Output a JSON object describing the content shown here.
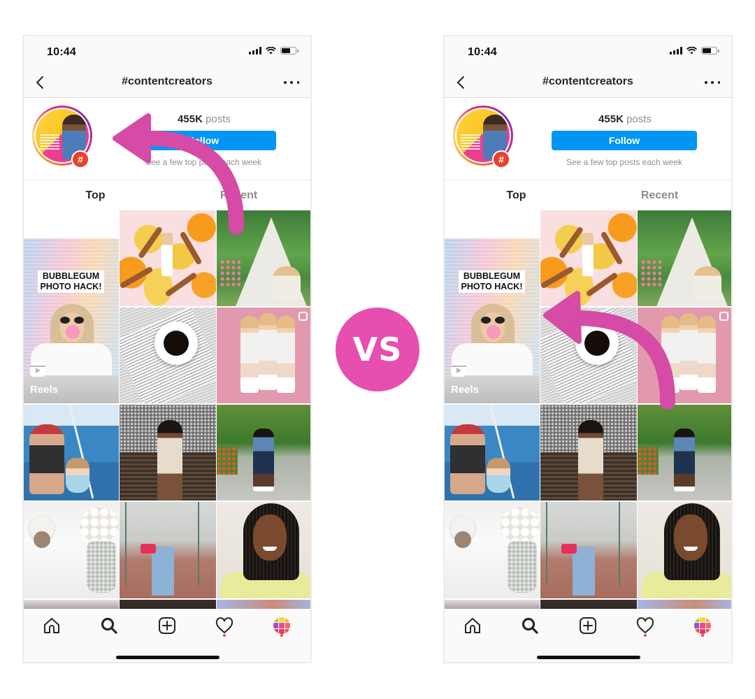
{
  "vs_label": "VS",
  "accent": {
    "arrow": "#d64ba6",
    "vs_circle": "#e64fb0",
    "follow": "#0095f6"
  },
  "phones": [
    {
      "id": "left",
      "arrow_target": "hashtag-profile-image",
      "status_bar": {
        "time": "10:44",
        "signal_icon": "cellular-signal-icon",
        "wifi_icon": "wifi-icon",
        "battery_icon": "battery-icon"
      },
      "header": {
        "back_icon": "chevron-left-icon",
        "title": "#contentcreators",
        "more_icon": "ellipsis-icon"
      },
      "hashtag": {
        "post_count": "455K",
        "post_label": "posts",
        "follow_label": "Follow",
        "follow_subtext": "See a few top posts each week",
        "badge": "#"
      },
      "tabs": [
        {
          "label": "Top",
          "active": true
        },
        {
          "label": "Recent",
          "active": false
        }
      ],
      "grid": {
        "reels_label": "Reels",
        "bubblegum_caption_1": "BUBBLEGUM",
        "bubblegum_caption_2": "PHOTO HACK!"
      },
      "bottom_nav": [
        "home-icon",
        "search-icon",
        "new-post-icon",
        "heart-icon",
        "profile-avatar"
      ]
    },
    {
      "id": "right",
      "arrow_target": "reels-thumbnail",
      "status_bar": {
        "time": "10:44",
        "signal_icon": "cellular-signal-icon",
        "wifi_icon": "wifi-icon",
        "battery_icon": "battery-icon"
      },
      "header": {
        "back_icon": "chevron-left-icon",
        "title": "#contentcreators",
        "more_icon": "ellipsis-icon"
      },
      "hashtag": {
        "post_count": "455K",
        "post_label": "posts",
        "follow_label": "Follow",
        "follow_subtext": "See a few top posts each week",
        "badge": "#"
      },
      "tabs": [
        {
          "label": "Top",
          "active": true
        },
        {
          "label": "Recent",
          "active": false
        }
      ],
      "grid": {
        "reels_label": "Reels",
        "bubblegum_caption_1": "BUBBLEGUM",
        "bubblegum_caption_2": "PHOTO HACK!"
      },
      "bottom_nav": [
        "home-icon",
        "search-icon",
        "new-post-icon",
        "heart-icon",
        "profile-avatar"
      ]
    }
  ]
}
